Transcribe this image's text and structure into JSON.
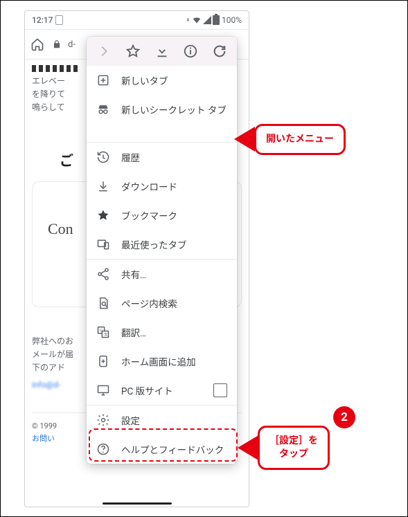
{
  "status": {
    "time": "12:17",
    "battery_pct": "100%"
  },
  "omnibox": {
    "url_text": "d-"
  },
  "background_page": {
    "para1_l1": "エレベー",
    "para1_l2": "を降りて",
    "para1_l3": "鳴らして",
    "heading_partial": "ご",
    "script_word": "Con",
    "para2_l1": "弊社へのお",
    "para2_l2": "メールが届",
    "para2_l3": "下のアド",
    "blurred_link": "info@d-",
    "copyright": "© 1999",
    "footer_link": "お問い"
  },
  "toolbar": {
    "forward_icon": "forward-icon",
    "star_icon": "star-icon",
    "download_icon": "download-icon",
    "info_icon": "info-icon",
    "reload_icon": "reload-icon"
  },
  "menu": {
    "new_tab": "新しいタブ",
    "incognito": "新しいシークレット タブ",
    "history": "履歴",
    "downloads": "ダウンロード",
    "bookmarks": "ブックマーク",
    "recent_tabs": "最近使ったタブ",
    "share": "共有…",
    "find": "ページ内検索",
    "translate": "翻訳…",
    "add_home": "ホーム画面に追加",
    "desktop": "PC 版サイト",
    "settings": "設定",
    "help": "ヘルプとフィードバック"
  },
  "callout1": {
    "text": "開いたメニュー"
  },
  "callout2": {
    "badge": "2",
    "line1": "［設定］を",
    "line2": "タップ"
  }
}
